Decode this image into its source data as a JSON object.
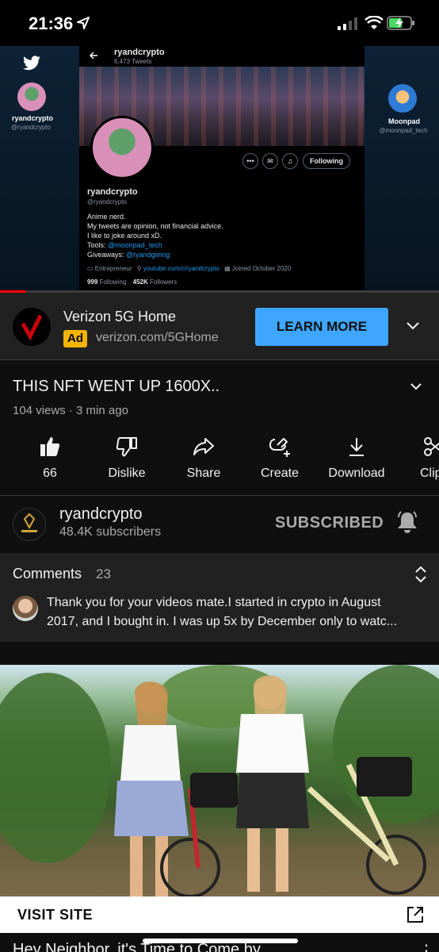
{
  "status_bar": {
    "time": "21:36"
  },
  "video": {
    "left_name": "ryandcrypto",
    "left_handle": "@ryandcrypto",
    "right_name": "Moonpad",
    "right_handle": "@moonpad_tech",
    "profile": {
      "header_name": "ryandcrypto",
      "tweets": "6,473 Tweets",
      "name": "ryandcrypto",
      "handle": "@ryandcrypto",
      "following_button": "Following",
      "bio_1": "Anime nerd.",
      "bio_2": "My tweets are opinion, not financial advice.",
      "bio_3": "I like to joke around xD.",
      "tools_label": "Tools:",
      "tools_link": "@moonpad_tech",
      "giveaways_label": "Giveaways:",
      "giveaways_link": "@ryandgiving",
      "category": "Entrepreneur",
      "link": "youtube.com/c/ryandcrypto",
      "joined": "Joined October 2020",
      "following_count": "999",
      "following_label": "Following",
      "followers_count": "452K",
      "followers_label": "Followers"
    },
    "progress": 0.06
  },
  "ad": {
    "title": "Verizon 5G Home",
    "badge": "Ad",
    "url": "verizon.com/5GHome",
    "cta": "LEARN MORE",
    "brand_color": "#cd040b"
  },
  "video_info": {
    "title": "THIS NFT WENT UP 1600X..",
    "meta": "104 views · 3 min ago"
  },
  "actions": [
    {
      "icon": "thumbs-up-icon",
      "label": "66"
    },
    {
      "icon": "thumbs-down-icon",
      "label": "Dislike"
    },
    {
      "icon": "share-icon",
      "label": "Share"
    },
    {
      "icon": "create-icon",
      "label": "Create"
    },
    {
      "icon": "download-icon",
      "label": "Download"
    },
    {
      "icon": "clip-icon",
      "label": "Clip"
    }
  ],
  "channel": {
    "name": "ryandcrypto",
    "subscribers": "48.4K subscribers",
    "subscribe_state": "SUBSCRIBED"
  },
  "comments": {
    "label": "Comments",
    "count": "23",
    "first_comment_line_1": "Thank you for your videos mate.I started in crypto in August",
    "first_comment_line_2": "2017, and I bought in.  I was up 5x by December only to watc..."
  },
  "ad2": {
    "visit_label": "VISIT SITE",
    "next_title": "Hey Neighbor, it's Time to Come by..."
  },
  "colors": {
    "background": "#0f0f0f",
    "surface": "#212121",
    "accent_blue": "#3ea6ff",
    "ad_badge": "#f4b400",
    "progress_red": "#ff0000"
  }
}
